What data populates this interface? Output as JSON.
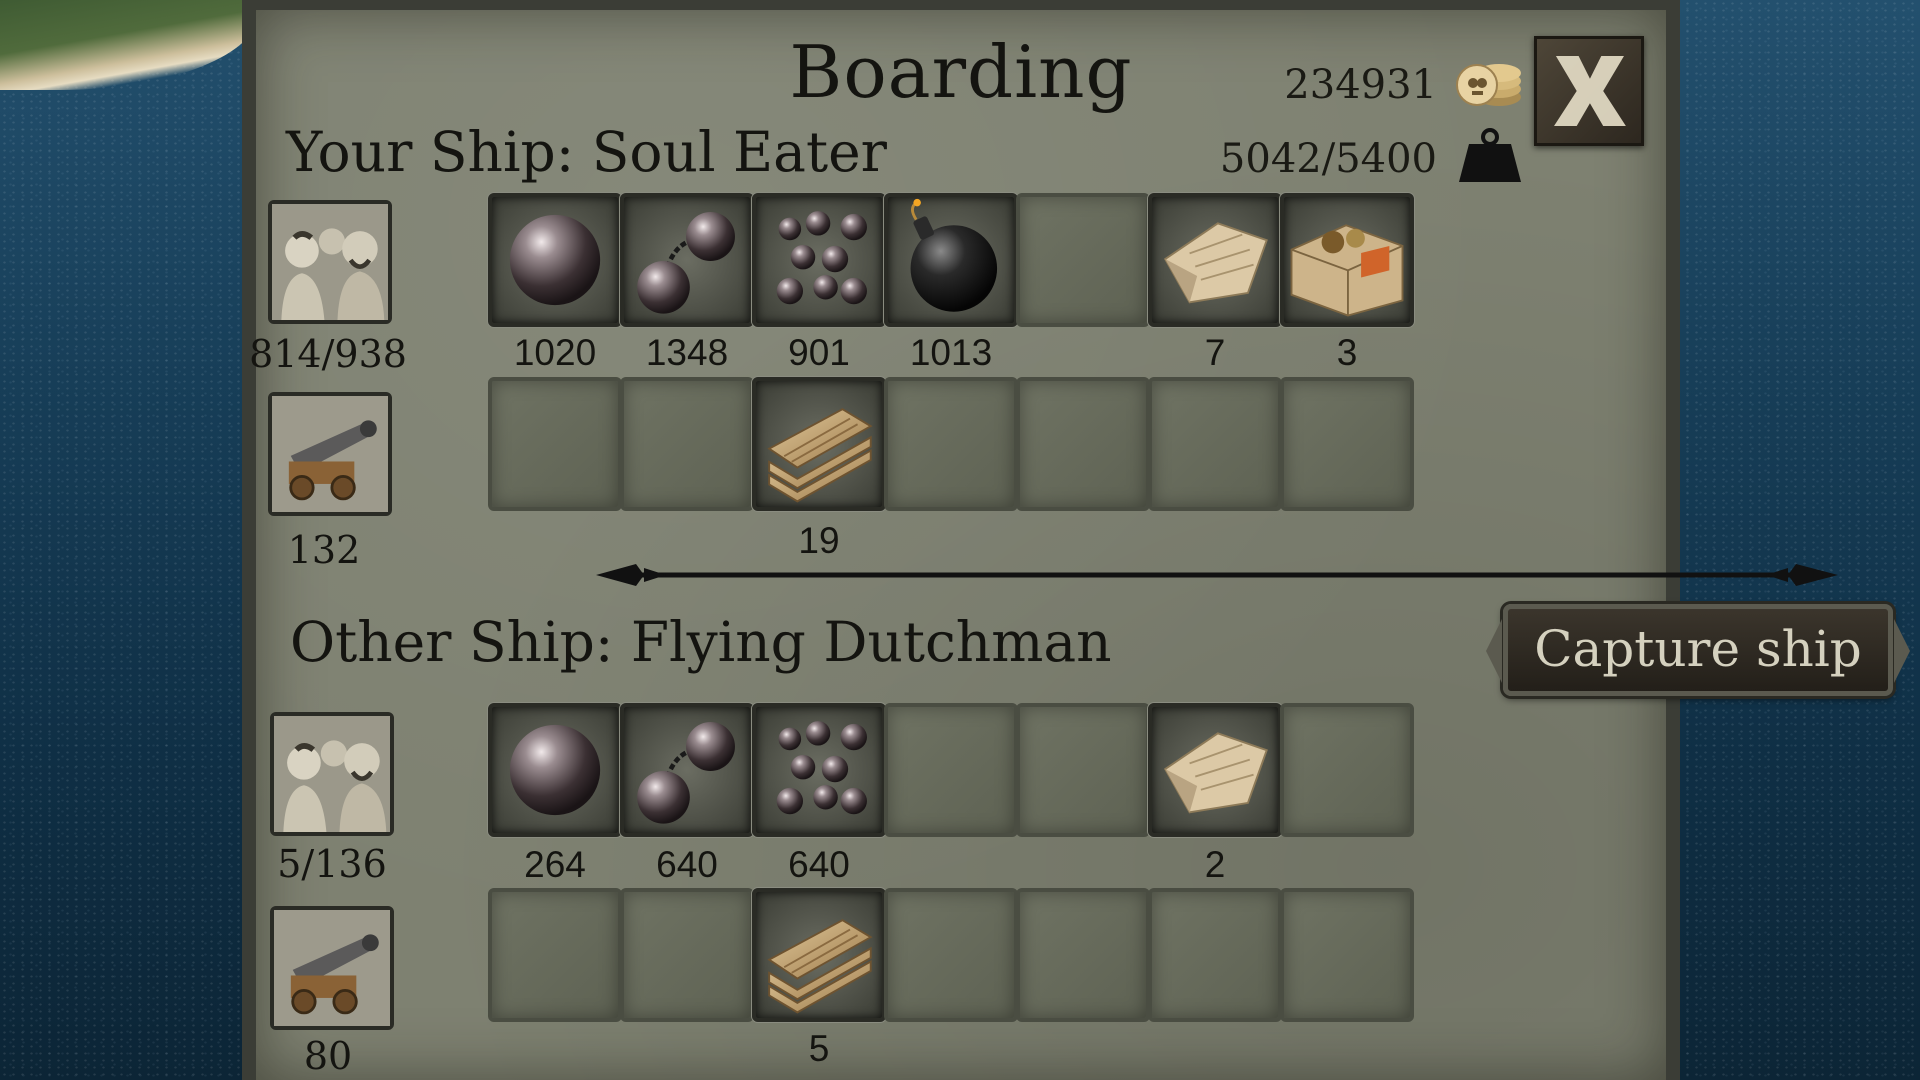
{
  "title": "Boarding",
  "gold": "234931",
  "cargo_weight": "5042/5400",
  "your_ship": {
    "label": "Your Ship: Soul Eater",
    "crew": "814/938",
    "cannons": "132",
    "row1": [
      {
        "item": "cannonball-icon",
        "count": "1020"
      },
      {
        "item": "chain-shot-icon",
        "count": "1348"
      },
      {
        "item": "grapeshot-icon",
        "count": "901"
      },
      {
        "item": "bomb-icon",
        "count": "1013"
      },
      {
        "item": "empty",
        "count": ""
      },
      {
        "item": "sailcloth-icon",
        "count": "7"
      },
      {
        "item": "supply-crate-icon",
        "count": "3"
      }
    ],
    "row2": [
      {
        "item": "empty",
        "count": ""
      },
      {
        "item": "empty",
        "count": ""
      },
      {
        "item": "planks-icon",
        "count": "19"
      },
      {
        "item": "empty",
        "count": ""
      },
      {
        "item": "empty",
        "count": ""
      },
      {
        "item": "empty",
        "count": ""
      },
      {
        "item": "empty",
        "count": ""
      }
    ]
  },
  "other_ship": {
    "label": "Other Ship: Flying Dutchman",
    "crew": "5/136",
    "cannons": "80",
    "row1": [
      {
        "item": "cannonball-icon",
        "count": "264"
      },
      {
        "item": "chain-shot-icon",
        "count": "640"
      },
      {
        "item": "grapeshot-icon",
        "count": "640"
      },
      {
        "item": "empty",
        "count": ""
      },
      {
        "item": "empty",
        "count": ""
      },
      {
        "item": "sailcloth-icon",
        "count": "2"
      },
      {
        "item": "empty",
        "count": ""
      }
    ],
    "row2": [
      {
        "item": "empty",
        "count": ""
      },
      {
        "item": "empty",
        "count": ""
      },
      {
        "item": "planks-icon",
        "count": "5"
      },
      {
        "item": "empty",
        "count": ""
      },
      {
        "item": "empty",
        "count": ""
      },
      {
        "item": "empty",
        "count": ""
      },
      {
        "item": "empty",
        "count": ""
      }
    ]
  },
  "capture_button": "Capture ship",
  "colors": {
    "panel": "#7e8171",
    "text": "#141410",
    "button_text": "#d5d1bf"
  }
}
